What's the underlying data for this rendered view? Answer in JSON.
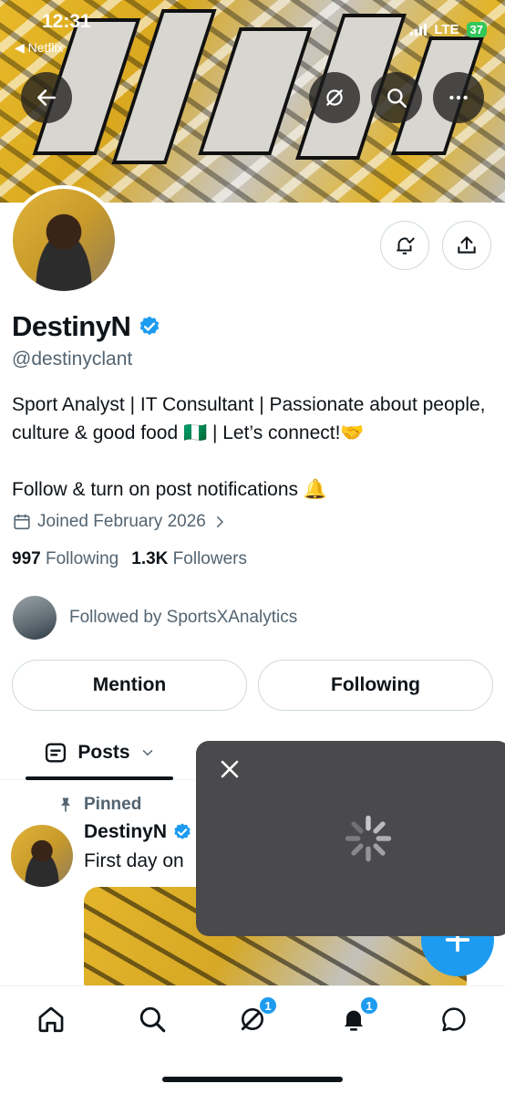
{
  "status_bar": {
    "time": "12:31",
    "back_app": "Netflix",
    "network": "LTE",
    "battery": "37"
  },
  "profile": {
    "display_name": "DestinyN",
    "handle": "@destinyclant",
    "bio_line1": "Sport Analyst | IT Consultant | Passionate about people, culture & good food 🇳🇬 | Let’s connect!🤝",
    "bio_line2": "Follow & turn on post notifications 🔔",
    "joined": "Joined February 2026",
    "following_count": "997",
    "following_label": "Following",
    "followers_count": "1.3K",
    "followers_label": "Followers",
    "followed_by": "Followed by SportsXAnalytics"
  },
  "buttons": {
    "mention": "Mention",
    "following": "Following"
  },
  "tabs": {
    "posts": "Posts"
  },
  "post": {
    "pinned_label": "Pinned",
    "author": "DestinyN",
    "text": "First day on"
  },
  "nav": {
    "grok_badge": "1",
    "notifications_badge": "1"
  },
  "colors": {
    "accent": "#1d9bf0",
    "verified": "#1d9bf0"
  }
}
